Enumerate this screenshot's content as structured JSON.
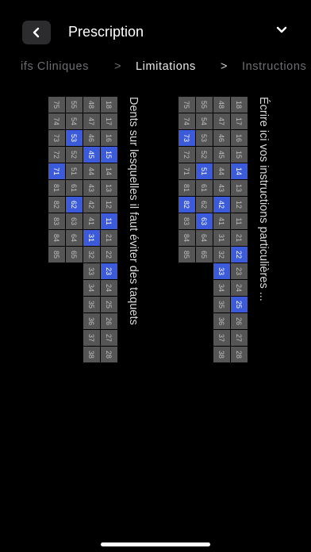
{
  "header": {
    "title": "Prescription",
    "back_icon": "chevron-left-icon",
    "menu_icon": "chevron-down-icon"
  },
  "breadcrumb": {
    "items": [
      "ifs Cliniques",
      "Limitations",
      "Instructions"
    ],
    "separator": ">"
  },
  "sections": [
    {
      "note": "Écrire ici vos instructions particulières ...",
      "rows": [
        {
          "teeth": [
            "18",
            "17",
            "16",
            "15",
            "14",
            "13",
            "12",
            "11",
            "21",
            "22",
            "23",
            "24",
            "25",
            "26",
            "27",
            "28"
          ],
          "selected": [
            "14",
            "22",
            "25"
          ]
        },
        {
          "teeth": [
            "48",
            "47",
            "46",
            "45",
            "44",
            "43",
            "42",
            "41",
            "31",
            "32",
            "33",
            "34",
            "35",
            "36",
            "37",
            "38"
          ],
          "selected": [
            "42",
            "33"
          ]
        },
        {
          "teeth": [
            "55",
            "54",
            "53",
            "52",
            "51",
            "61",
            "62",
            "63",
            "64",
            "65"
          ],
          "selected": [
            "51",
            "63"
          ]
        },
        {
          "teeth": [
            "75",
            "74",
            "73",
            "72",
            "71",
            "81",
            "82",
            "83",
            "84",
            "85"
          ],
          "selected": [
            "73",
            "82"
          ]
        }
      ]
    },
    {
      "note": "Dents sur lesquelles il faut éviter des taquets",
      "rows": [
        {
          "teeth": [
            "18",
            "17",
            "16",
            "15",
            "14",
            "13",
            "12",
            "11",
            "21",
            "22",
            "23",
            "24",
            "25",
            "26",
            "27",
            "28"
          ],
          "selected": [
            "15",
            "11",
            "23"
          ]
        },
        {
          "teeth": [
            "48",
            "47",
            "46",
            "45",
            "44",
            "43",
            "42",
            "41",
            "31",
            "32",
            "33",
            "34",
            "35",
            "36",
            "37",
            "38"
          ],
          "selected": [
            "45",
            "31"
          ]
        },
        {
          "teeth": [
            "55",
            "54",
            "53",
            "52",
            "51",
            "61",
            "62",
            "63",
            "64",
            "65"
          ],
          "selected": [
            "53",
            "62"
          ]
        },
        {
          "teeth": [
            "75",
            "74",
            "73",
            "72",
            "71",
            "81",
            "82",
            "83",
            "84",
            "85"
          ],
          "selected": [
            "71"
          ]
        }
      ]
    }
  ],
  "colors": {
    "background": "#000000",
    "cell": "#555555",
    "cell_selected": "#3b5bdb"
  }
}
